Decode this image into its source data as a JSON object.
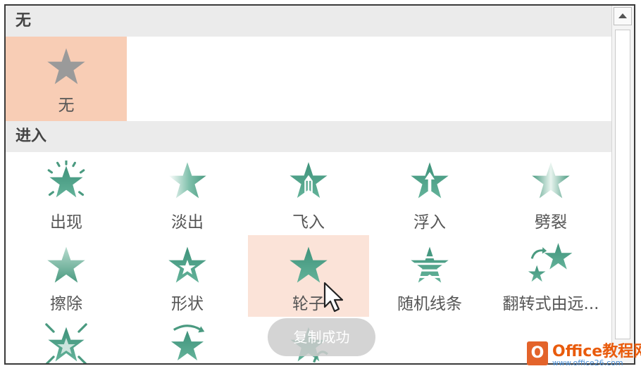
{
  "sections": {
    "none_header": "无",
    "entrance_header": "进入"
  },
  "tiles": {
    "none": "无",
    "appear": "出现",
    "fade": "淡出",
    "fly_in": "飞入",
    "float_in": "浮入",
    "split": "劈裂",
    "wipe": "擦除",
    "shape": "形状",
    "wheel": "轮子",
    "random_bars": "随机线条",
    "grow_turn": "翻转式由远..."
  },
  "toast": "复制成功",
  "watermark": {
    "title": "Office教程网",
    "url": "www.office26.com"
  },
  "colors": {
    "accent": "#4a9a80",
    "selected": "#f8cdb5",
    "hover": "#fbe3d8",
    "header": "#ebebeb"
  },
  "icons": {
    "star": "star-icon",
    "scroll_up": "chevron-up-icon",
    "cursor": "mouse-pointer-icon"
  }
}
